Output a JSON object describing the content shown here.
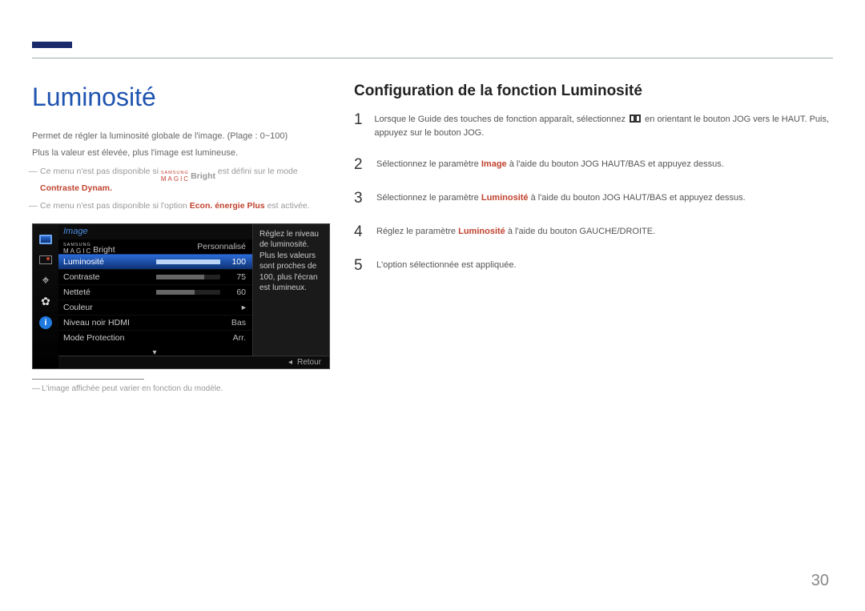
{
  "pageNumber": "30",
  "left": {
    "title": "Luminosité",
    "p1": "Permet de régler la luminosité globale de l'image. (Plage : 0~100)",
    "p2": "Plus la valeur est élevée, plus l'image est lumineuse.",
    "note1_pre": "Ce menu n'est pas disponible si ",
    "note1_mid": "Bright",
    "note1_post": " est défini sur le mode ",
    "note1_accent": "Contraste Dynam.",
    "note2_pre": "Ce menu n'est pas disponible si l'option ",
    "note2_accent": "Econ. énergie Plus",
    "note2_post": " est activée.",
    "magic_top": "SAMSUNG",
    "magic_bot": "MAGIC",
    "footnote": "L'image affichée peut varier en fonction du modèle."
  },
  "osd": {
    "title": "Image",
    "items": {
      "magicBright": {
        "label": "Bright",
        "value": "Personnalisé"
      },
      "luminosite": {
        "label": "Luminosité",
        "value": "100",
        "pct": 100
      },
      "contraste": {
        "label": "Contraste",
        "value": "75",
        "pct": 75
      },
      "nettete": {
        "label": "Netteté",
        "value": "60",
        "pct": 60
      },
      "couleur": {
        "label": "Couleur",
        "value": "▸"
      },
      "hdmi": {
        "label": "Niveau noir HDMI",
        "value": "Bas"
      },
      "protection": {
        "label": "Mode Protection",
        "value": "Arr."
      }
    },
    "help": "Réglez le niveau de luminosité. Plus les valeurs sont proches de 100, plus l'écran est lumineux.",
    "back": "Retour"
  },
  "right": {
    "title": "Configuration de la fonction Luminosité",
    "s1": {
      "n": "1",
      "a": "Lorsque le Guide des touches de fonction apparaît, sélectionnez ",
      "b": " en orientant le bouton JOG vers le HAUT. Puis, appuyez sur le bouton JOG."
    },
    "s2": {
      "n": "2",
      "a": "Sélectionnez le paramètre ",
      "k": "Image",
      "b": " à l'aide du bouton JOG HAUT/BAS et appuyez dessus."
    },
    "s3": {
      "n": "3",
      "a": "Sélectionnez le paramètre ",
      "k": "Luminosité",
      "b": " à l'aide du bouton JOG HAUT/BAS et appuyez dessus."
    },
    "s4": {
      "n": "4",
      "a": "Réglez le paramètre ",
      "k": "Luminosité",
      "b": " à l'aide du bouton GAUCHE/DROITE."
    },
    "s5": {
      "n": "5",
      "a": "L'option sélectionnée est appliquée."
    }
  }
}
